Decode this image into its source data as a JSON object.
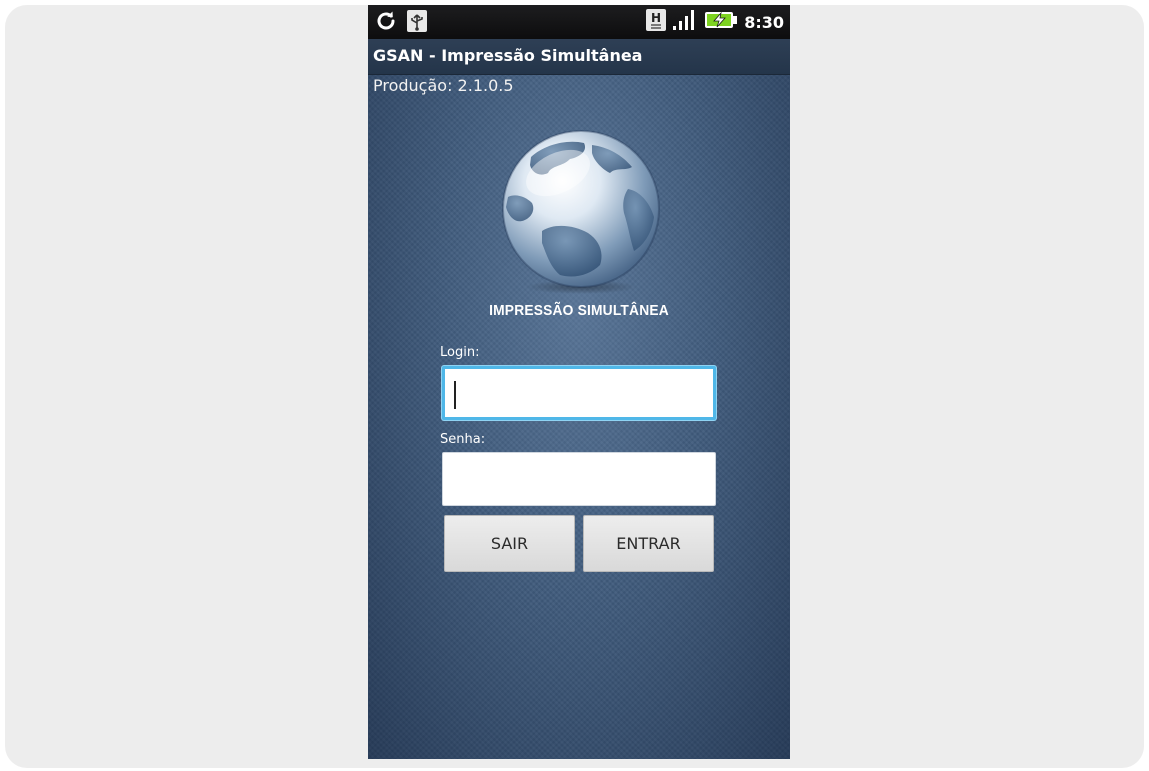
{
  "status_bar": {
    "time": "8:30",
    "icons": [
      "sync-icon",
      "usb-icon",
      "hsdpa-icon",
      "signal-icon",
      "battery-charging-icon"
    ],
    "hsdpa_label": "H"
  },
  "app": {
    "title": "GSAN - Impressão Simultânea",
    "version": "Produção: 2.1.0.5"
  },
  "logo": {
    "caption": "IMPRESSÃO SIMULTÂNEA"
  },
  "login": {
    "label": "Login:",
    "value": ""
  },
  "password": {
    "label": "Senha:",
    "value": ""
  },
  "buttons": {
    "exit": "SAIR",
    "enter": "ENTRAR"
  },
  "colors": {
    "background": "#3f5a7b",
    "title_bar": "#2a3b50",
    "focus_border": "#4fb7e8",
    "button": "#e3e3e3"
  }
}
